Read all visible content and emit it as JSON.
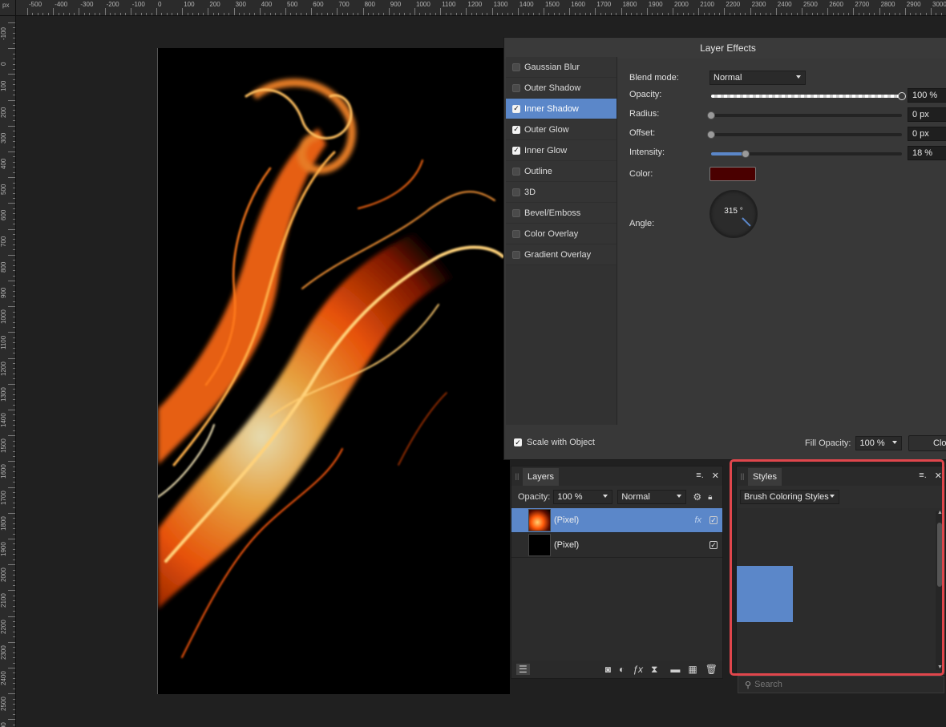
{
  "ruler": {
    "unit": "px",
    "top_ticks": [
      "-500",
      "-400",
      "-300",
      "-200",
      "-100",
      "0",
      "100",
      "200",
      "300",
      "400",
      "500",
      "600",
      "700",
      "800",
      "900",
      "1000",
      "1100",
      "1200",
      "1300",
      "1400",
      "1500",
      "1600",
      "1700",
      "1800",
      "1900",
      "2000",
      "2100",
      "2200",
      "2300",
      "2400",
      "2500",
      "2600",
      "2700",
      "2800",
      "2900",
      "3000"
    ],
    "left_ticks": [
      "-100",
      "0",
      "100",
      "200",
      "300",
      "400",
      "500",
      "600",
      "700",
      "800",
      "900",
      "1000",
      "1100",
      "1200",
      "1300",
      "1400",
      "1500",
      "1600",
      "1700",
      "1800",
      "1900",
      "2000",
      "2100",
      "2200",
      "2300",
      "2400",
      "2500",
      "2600"
    ]
  },
  "layer_effects": {
    "title": "Layer Effects",
    "effects": [
      {
        "label": "Gaussian Blur",
        "checked": false,
        "selected": false
      },
      {
        "label": "Outer Shadow",
        "checked": false,
        "selected": false
      },
      {
        "label": "Inner Shadow",
        "checked": true,
        "selected": true
      },
      {
        "label": "Outer Glow",
        "checked": true,
        "selected": false
      },
      {
        "label": "Inner Glow",
        "checked": true,
        "selected": false
      },
      {
        "label": "Outline",
        "checked": false,
        "selected": false
      },
      {
        "label": "3D",
        "checked": false,
        "selected": false
      },
      {
        "label": "Bevel/Emboss",
        "checked": false,
        "selected": false
      },
      {
        "label": "Color Overlay",
        "checked": false,
        "selected": false
      },
      {
        "label": "Gradient Overlay",
        "checked": false,
        "selected": false
      }
    ],
    "blend_mode_label": "Blend mode:",
    "blend_mode_value": "Normal",
    "opacity_label": "Opacity:",
    "opacity_value": "100 %",
    "opacity_level": 1.0,
    "radius_label": "Radius:",
    "radius_value": "0 px",
    "radius_level": 0.0,
    "offset_label": "Offset:",
    "offset_value": "0 px",
    "offset_level": 0.0,
    "intensity_label": "Intensity:",
    "intensity_value": "18 %",
    "intensity_level": 0.18,
    "color_label": "Color:",
    "color_value": "#4a0000",
    "angle_label": "Angle:",
    "angle_value": "315 °",
    "scale_label": "Scale with Object",
    "scale_checked": true,
    "fill_opacity_label": "Fill Opacity:",
    "fill_opacity_value": "100 %",
    "close_label": "Close"
  },
  "layers_panel": {
    "tab": "Layers",
    "opacity_label": "Opacity:",
    "opacity_value": "100 %",
    "blend_value": "Normal",
    "layers": [
      {
        "name": "(Pixel)",
        "selected": true,
        "has_fx": true,
        "visible": true
      },
      {
        "name": "(Pixel)",
        "selected": false,
        "has_fx": false,
        "visible": true
      }
    ],
    "fx_label": "fx"
  },
  "styles_panel": {
    "tab": "Styles",
    "category": "Brush Coloring Styles",
    "swatch_color": "#5b87c9",
    "search_placeholder": "Search"
  },
  "colors": {
    "accent": "#5b87c9",
    "highlight": "#e0464c"
  }
}
